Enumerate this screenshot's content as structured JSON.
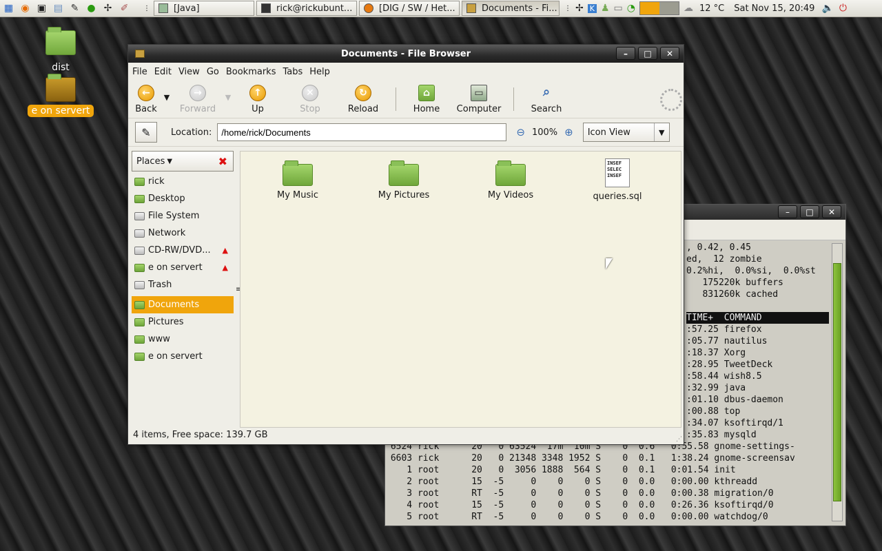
{
  "panel": {
    "launchers": [
      "apps-menu-icon",
      "firefox-icon",
      "terminal-icon",
      "file-manager-icon",
      "notepad-icon",
      "green-ball-icon",
      "bird-icon",
      "text-editor-icon"
    ],
    "tasks": [
      {
        "label": "[Java]"
      },
      {
        "label": "rick@rickubunt..."
      },
      {
        "label": "[DIG / SW / Het..."
      },
      {
        "label": "Documents - Fi..."
      }
    ],
    "weather": "12 °C",
    "clock": "Sat Nov 15, 20:49"
  },
  "desktop": {
    "icons": [
      {
        "label": "dist"
      },
      {
        "label": "e on servert"
      }
    ]
  },
  "terminal": {
    "lines": [
      ", 0.42, 0.45",
      "ed,  12 zombie",
      "0.2%hi,  0.0%si,  0.0%st",
      "   175220k buffers",
      "   831260k cached",
      "",
      "TIME+  COMMAND",
      ":57.25 firefox",
      ":05.77 nautilus",
      ":18.37 Xorg",
      ":28.95 TweetDeck",
      ":58.44 wish8.5",
      ":32.99 java",
      ":01.10 dbus-daemon",
      ":00.88 top",
      ":34.07 ksoftirqd/1",
      ":35.83 mysqld",
      " 6524 rick      20   0 63524  17m  10m S    0  0.6   0:55.58 gnome-settings-",
      " 6603 rick      20   0 21348 3348 1952 S    0  0.1   1:38.24 gnome-screensav",
      "    1 root      20   0  3056 1888  564 S    0  0.1   0:01.54 init",
      "    2 root      15  -5     0    0    0 S    0  0.0   0:00.00 kthreadd",
      "    3 root      RT  -5     0    0    0 S    0  0.0   0:00.38 migration/0",
      "    4 root      15  -5     0    0    0 S    0  0.0   0:26.36 ksoftirqd/0",
      "    5 root      RT  -5     0    0    0 S    0  0.0   0:00.00 watchdog/0"
    ]
  },
  "window": {
    "title": "Documents - File Browser",
    "menu": [
      "File",
      "Edit",
      "View",
      "Go",
      "Bookmarks",
      "Tabs",
      "Help"
    ],
    "toolbar": {
      "back": "Back",
      "forward": "Forward",
      "up": "Up",
      "stop": "Stop",
      "reload": "Reload",
      "home": "Home",
      "computer": "Computer",
      "search": "Search"
    },
    "location_label": "Location:",
    "location_value": "/home/rick/Documents",
    "zoom": "100%",
    "view_mode": "Icon View",
    "sidebar": {
      "header": "Places",
      "items": [
        {
          "label": "rick"
        },
        {
          "label": "Desktop"
        },
        {
          "label": "File System"
        },
        {
          "label": "Network"
        },
        {
          "label": "CD-RW/DVD..."
        },
        {
          "label": "e on servert"
        },
        {
          "label": "Trash"
        },
        {
          "label": "Documents"
        },
        {
          "label": "Pictures"
        },
        {
          "label": "www"
        },
        {
          "label": "e on servert"
        }
      ]
    },
    "files": [
      {
        "name": "My Music"
      },
      {
        "name": "My Pictures"
      },
      {
        "name": "My Videos"
      },
      {
        "name": "queries.sql",
        "preview": [
          "INSEF",
          "SELEC",
          "",
          "INSEF"
        ]
      }
    ],
    "status": "4 items, Free space: 139.7 GB"
  }
}
